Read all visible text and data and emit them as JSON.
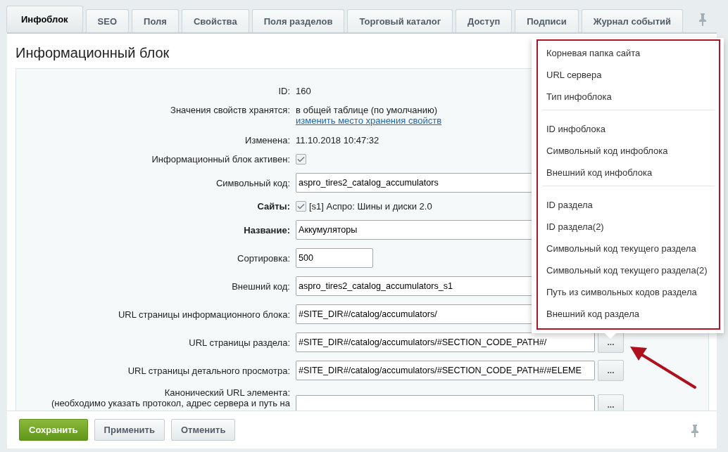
{
  "tabs": [
    {
      "label": "Инфоблок",
      "selected": true
    },
    {
      "label": "SEO",
      "selected": false
    },
    {
      "label": "Поля",
      "selected": false
    },
    {
      "label": "Свойства",
      "selected": false
    },
    {
      "label": "Поля разделов",
      "selected": false
    },
    {
      "label": "Торговый каталог",
      "selected": false
    },
    {
      "label": "Доступ",
      "selected": false
    },
    {
      "label": "Подписи",
      "selected": false
    },
    {
      "label": "Журнал событий",
      "selected": false
    }
  ],
  "title": "Информационный блок",
  "fields": [
    {
      "kind": "text",
      "label": "ID:",
      "value": "160"
    },
    {
      "kind": "text-link",
      "label": "Значения свойств хранятся:",
      "value": "в общей таблице (по умолчанию)",
      "link": "изменить место хранения свойств"
    },
    {
      "kind": "text",
      "label": "Изменена:",
      "value": "11.10.2018 10:47:32"
    },
    {
      "kind": "checkbox",
      "label": "Информационный блок активен:",
      "checked": true
    },
    {
      "kind": "input",
      "label": "Символьный код:",
      "value": "aspro_tires2_catalog_accumulators"
    },
    {
      "kind": "checkbox",
      "label": "Сайты:",
      "bold": true,
      "checked": true,
      "value": "[s1] Аспро: Шины и диски 2.0"
    },
    {
      "kind": "input",
      "label": "Название:",
      "bold": true,
      "value": "Аккумуляторы"
    },
    {
      "kind": "short-input",
      "label": "Сортировка:",
      "value": "500"
    },
    {
      "kind": "input",
      "label": "Внешний код:",
      "value": "aspro_tires2_catalog_accumulators_s1"
    },
    {
      "kind": "input",
      "label": "URL страницы информационного блока:",
      "value": "#SITE_DIR#/catalog/accumulators/"
    },
    {
      "kind": "input-button",
      "label": "URL страницы раздела:",
      "value": "#SITE_DIR#/catalog/accumulators/#SECTION_CODE_PATH#/",
      "button": "..."
    },
    {
      "kind": "input-button",
      "label": "URL страницы детального просмотра:",
      "value": "#SITE_DIR#/catalog/accumulators/#SECTION_CODE_PATH#/#ELEME",
      "button": "..."
    },
    {
      "kind": "input-button",
      "label": "Канонический URL элемента:",
      "note": "(необходимо указать протокол, адрес сервера и путь на",
      "button": "..."
    }
  ],
  "menu": [
    [
      "Корневая папка сайта",
      "URL сервера",
      "Тип инфоблока"
    ],
    [
      "ID инфоблока",
      "Символьный код инфоблока",
      "Внешний код инфоблока"
    ],
    [
      "ID раздела",
      "ID раздела(2)",
      "Символьный код текущего раздела",
      "Символьный код текущего раздела(2)",
      "Путь из символьных кодов раздела",
      "Внешний код раздела"
    ]
  ],
  "buttons": [
    {
      "label": "Сохранить",
      "kind": "primary"
    },
    {
      "label": "Применить",
      "kind": "default"
    },
    {
      "label": "Отменить",
      "kind": "default"
    }
  ]
}
